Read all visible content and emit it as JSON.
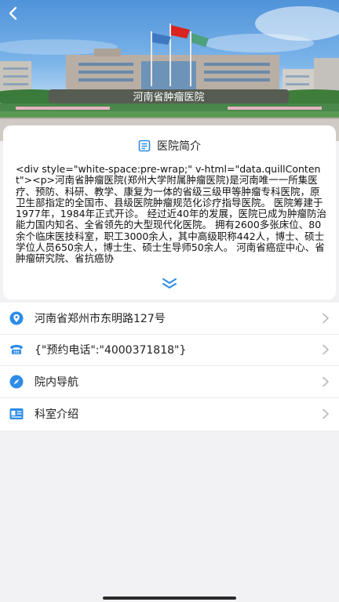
{
  "header": {
    "back_icon": "chevron-left-icon",
    "building_sign": "河南省肿瘤医院"
  },
  "intro": {
    "icon": "document-icon",
    "title": "医院简介",
    "content": "<div style=\"white-space:pre-wrap;\" v-html=\"data.quillContent\"><p>河南省肿瘤医院(郑州大学附属肿瘤医院)是河南唯一一所集医疗、预防、科研、教学、康复为一体的省级三级甲等肿瘤专科医院，原卫生部指定的全国市、县级医院肿瘤规范化诊疗指导医院。 医院筹建于1977年，1984年正式开诊。 经过近40年的发展，医院已成为肿瘤防治能力国内知名、全省领先的大型现代化医院。 拥有2600多张床位、80余个临床医技科室，职工3000余人，其中高级职称442人，博士、硕士学位人员650余人，博士生、硕士生导师50余人。 河南省癌症中心、省肿瘤研究院、省抗癌协",
    "expand_icon": "double-chevron-down-icon"
  },
  "menu": [
    {
      "name": "address",
      "icon": "location-pin-icon",
      "label": "河南省郑州市东明路127号",
      "chevron": "chevron-right-icon"
    },
    {
      "name": "phone",
      "icon": "phone-icon",
      "label": "{\"预约电话\":\"4000371818\"}",
      "chevron": "chevron-right-icon"
    },
    {
      "name": "navigation",
      "icon": "compass-icon",
      "label": "院内导航",
      "chevron": "chevron-right-icon"
    },
    {
      "name": "departments",
      "icon": "department-card-icon",
      "label": "科室介绍",
      "chevron": "chevron-right-icon"
    }
  ],
  "colors": {
    "accent": "#2d8ce8",
    "background": "#f2f2f4",
    "card": "#ffffff",
    "chevron": "#b9b9b9"
  }
}
